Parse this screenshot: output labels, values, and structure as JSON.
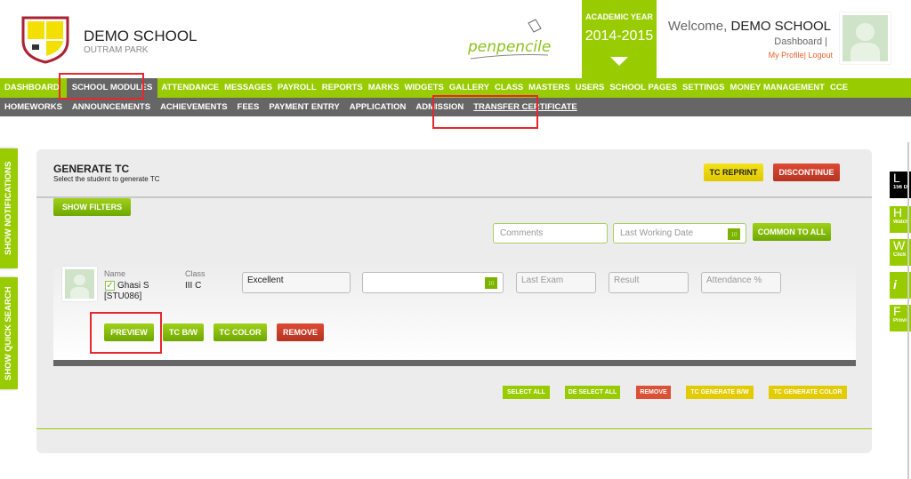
{
  "header": {
    "school_name": "DEMO SCHOOL",
    "school_location": "OUTRAM PARK",
    "brand_logo": "penpencileraser",
    "academic_year_label": "ACADEMIC YEAR",
    "academic_year": "2014-2015",
    "welcome_prefix": "Welcome,",
    "welcome_user": "DEMO SCHOOL",
    "dashboard_link": "Dashboard |",
    "my_profile": "My Profile|",
    "logout": "Logout"
  },
  "nav": {
    "items": [
      "DASHBOARD",
      "SCHOOL MODULES",
      "ATTENDANCE",
      "MESSAGES",
      "PAYROLL",
      "REPORTS",
      "MARKS",
      "WIDGETS",
      "GALLERY",
      "CLASS",
      "MASTERS",
      "USERS",
      "SCHOOL PAGES",
      "SETTINGS",
      "MONEY MANAGEMENT",
      "CCE"
    ],
    "active": "SCHOOL MODULES"
  },
  "subnav": {
    "items": [
      "HOMEWORKS",
      "ANNOUNCEMENTS",
      "ACHIEVEMENTS",
      "FEES",
      "PAYMENT ENTRY",
      "APPLICATION",
      "ADMISSION",
      "TRANSFER CERTIFICATE"
    ],
    "active": "TRANSFER CERTIFICATE"
  },
  "side": {
    "notifications": "SHOW NOTIFICATIONS",
    "quick_search": "SHOW QUICK SEARCH"
  },
  "right_tabs": [
    {
      "key": "L",
      "sub": "156 D"
    },
    {
      "key": "H",
      "sub": "Watch"
    },
    {
      "key": "W",
      "sub": "Click"
    },
    {
      "key": "i",
      "sub": ""
    },
    {
      "key": "F",
      "sub": "Provi"
    }
  ],
  "main": {
    "title": "GENERATE TC",
    "subtitle": "Select the student to generate TC",
    "tc_reprint": "TC REPRINT",
    "discontinue": "DISCONTINUE",
    "show_filters": "SHOW FILTERS",
    "comments_placeholder": "Comments",
    "last_working_date_placeholder": "Last Working Date",
    "calendar_day": "10",
    "common_to_all": "COMMON TO ALL"
  },
  "student": {
    "name_label": "Name",
    "class_label": "Class",
    "name": "Ghasi S",
    "id": "[STU086]",
    "class": "III C",
    "conduct": "Excellent",
    "checked": true,
    "last_exam_placeholder": "Last Exam",
    "result_placeholder": "Result",
    "attendance_placeholder": "Attendance %",
    "preview": "PREVIEW",
    "tc_bw": "TC B/W",
    "tc_color": "TC COLOR",
    "remove": "REMOVE"
  },
  "bulk": {
    "select_all": "SELECT ALL",
    "deselect_all": "DE SELECT ALL",
    "remove": "REMOVE",
    "tc_generate_bw": "TC GENERATE B/W",
    "tc_generate_color": "TC GENERATE COLOR"
  },
  "colors": {
    "brand_green": "#99cc00",
    "nav_gray": "#666666",
    "danger": "#dd4a36",
    "warning": "#e2cc00",
    "highlight": "#e8262d"
  }
}
